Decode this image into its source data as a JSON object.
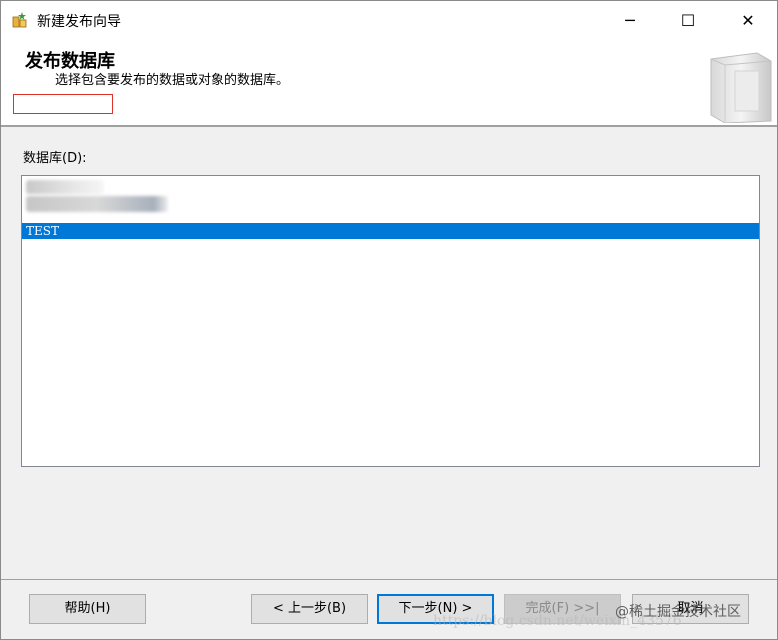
{
  "window": {
    "title": "新建发布向导",
    "icon": "publication-wizard-icon",
    "controls": {
      "minimize": "─",
      "maximize": "☐",
      "close": "✕"
    }
  },
  "header": {
    "title": "发布数据库",
    "subtitle": "选择包含要发布的数据或对象的数据库。"
  },
  "main": {
    "database_label": "数据库(D):",
    "databases": [
      {
        "label": "TEST",
        "selected": true
      }
    ]
  },
  "buttons": {
    "help": "帮助(H)",
    "back": "< 上一步(B)",
    "next": "下一步(N) >",
    "finish": "完成(F) >>|",
    "cancel": "取消"
  },
  "watermark": {
    "text": "@稀土掘金技术社区",
    "url": "https://blog.csdn.net/weixin_43576"
  },
  "colors": {
    "selection": "#0078d7",
    "highlight_box": "#e0302a",
    "panel": "#f0f0f0"
  }
}
